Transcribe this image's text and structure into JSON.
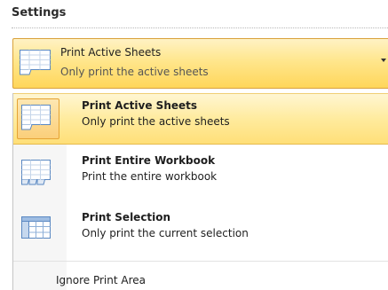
{
  "settings": {
    "title": "Settings"
  },
  "dropdown": {
    "selected_title": "Print Active Sheets",
    "selected_desc": "Only print the active sheets",
    "icon": "sheet-icon"
  },
  "menu": {
    "items": [
      {
        "title": "Print Active Sheets",
        "desc": "Only print the active sheets",
        "icon": "active-sheets-icon",
        "highlighted": true
      },
      {
        "title": "Print Entire Workbook",
        "desc": "Print the entire workbook",
        "icon": "workbook-icon",
        "highlighted": false
      },
      {
        "title": "Print Selection",
        "desc": "Only print the current selection",
        "icon": "selection-icon",
        "highlighted": false
      }
    ],
    "ignore_print_area": "Ignore Print Area"
  },
  "colors": {
    "highlight_top": "#fff6d2",
    "highlight_bottom": "#ffdf78",
    "highlight_border": "#e5b94c",
    "sheet_blue": "#5a88c2"
  }
}
